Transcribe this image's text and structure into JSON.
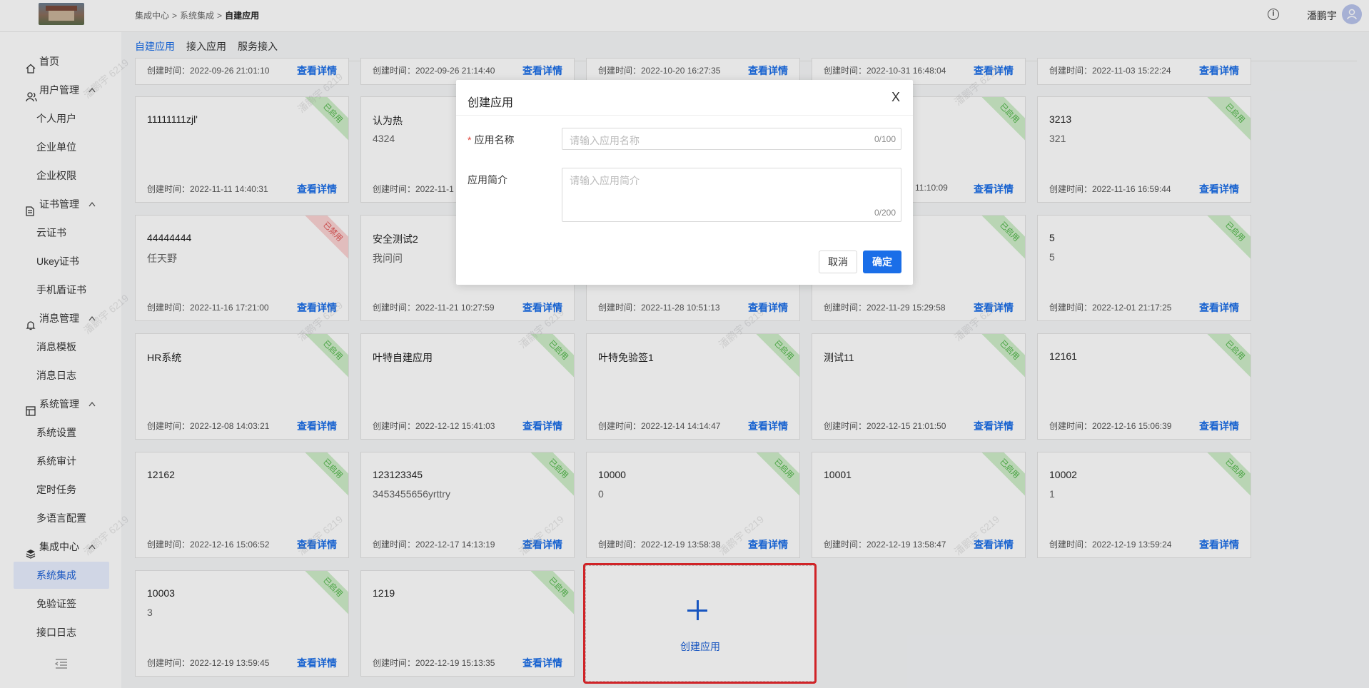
{
  "header": {
    "breadcrumb": [
      "集成中心",
      "系统集成",
      "自建应用"
    ],
    "breadcrumb_sep": ">",
    "username": "潘鹏宇"
  },
  "sidebar": {
    "items": [
      {
        "label": "首页",
        "icon": "home-icon",
        "type": "group"
      },
      {
        "label": "用户管理",
        "icon": "users-icon",
        "type": "group",
        "expanded": true
      },
      {
        "label": "个人用户",
        "type": "child"
      },
      {
        "label": "企业单位",
        "type": "child"
      },
      {
        "label": "企业权限",
        "type": "child"
      },
      {
        "label": "证书管理",
        "icon": "certificate-icon",
        "type": "group",
        "expanded": true
      },
      {
        "label": "云证书",
        "type": "child"
      },
      {
        "label": "Ukey证书",
        "type": "child"
      },
      {
        "label": "手机盾证书",
        "type": "child"
      },
      {
        "label": "消息管理",
        "icon": "bell-icon",
        "type": "group",
        "expanded": true
      },
      {
        "label": "消息模板",
        "type": "child"
      },
      {
        "label": "消息日志",
        "type": "child"
      },
      {
        "label": "系统管理",
        "icon": "system-icon",
        "type": "group",
        "expanded": true
      },
      {
        "label": "系统设置",
        "type": "child"
      },
      {
        "label": "系统审计",
        "type": "child"
      },
      {
        "label": "定时任务",
        "type": "child"
      },
      {
        "label": "多语言配置",
        "type": "child"
      },
      {
        "label": "集成中心",
        "icon": "layers-icon",
        "type": "group",
        "expanded": true
      },
      {
        "label": "系统集成",
        "type": "child",
        "active": true
      },
      {
        "label": "免验证签",
        "type": "child"
      },
      {
        "label": "接口日志",
        "type": "child"
      }
    ]
  },
  "tabs": [
    "自建应用",
    "接入应用",
    "服务接入"
  ],
  "detail_label": "查看详情",
  "time_prefix": "创建时间：",
  "status": {
    "enabled": "已启用",
    "disabled": "已禁用"
  },
  "cards_partial_row": [
    {
      "time": "2022-09-26 21:01:10"
    },
    {
      "time": "2022-09-26 21:14:40"
    },
    {
      "time": "2022-10-20 16:27:35"
    },
    {
      "time": "2022-10-31 16:48:04"
    },
    {
      "time": "2022-11-03 15:22:24"
    }
  ],
  "cards": [
    {
      "name": "11111111zjl'",
      "desc": "",
      "time": "2022-11-11 14:40:31",
      "status": "enabled"
    },
    {
      "name": "认为热",
      "desc": "4324",
      "time": "2022-11-1",
      "status": "enabled"
    },
    {
      "name": "",
      "desc": "",
      "time": "",
      "status": "enabled"
    },
    {
      "name": "",
      "desc": "",
      "time": "11:10:09",
      "status": "enabled"
    },
    {
      "name": "3213",
      "desc": "321",
      "time": "2022-11-16 16:59:44",
      "status": "enabled"
    },
    {
      "name": "44444444",
      "desc": "任天野",
      "time": "2022-11-16 17:21:00",
      "status": "disabled"
    },
    {
      "name": "安全测试2",
      "desc": "我问问",
      "time": "2022-11-21 10:27:59",
      "status": "enabled"
    },
    {
      "name": "",
      "desc": "",
      "time": "2022-11-28 10:51:13",
      "status": "enabled"
    },
    {
      "name": "",
      "desc": "",
      "time": "2022-11-29 15:29:58",
      "status": "enabled"
    },
    {
      "name": "5",
      "desc": "5",
      "time": "2022-12-01 21:17:25",
      "status": "enabled"
    },
    {
      "name": "HR系统",
      "desc": "",
      "time": "2022-12-08 14:03:21",
      "status": "enabled"
    },
    {
      "name": "叶特自建应用",
      "desc": "",
      "time": "2022-12-12 15:41:03",
      "status": "enabled"
    },
    {
      "name": "叶特免验签1",
      "desc": "",
      "time": "2022-12-14 14:14:47",
      "status": "enabled"
    },
    {
      "name": "测试11",
      "desc": "",
      "time": "2022-12-15 21:01:50",
      "status": "enabled"
    },
    {
      "name": "12161",
      "desc": "",
      "time": "2022-12-16 15:06:39",
      "status": "enabled"
    },
    {
      "name": "12162",
      "desc": "",
      "time": "2022-12-16 15:06:52",
      "status": "enabled"
    },
    {
      "name": "123123345",
      "desc": "3453455656yrttry",
      "time": "2022-12-17 14:13:19",
      "status": "enabled"
    },
    {
      "name": "10000",
      "desc": "0",
      "time": "2022-12-19 13:58:38",
      "status": "enabled"
    },
    {
      "name": "10001",
      "desc": "",
      "time": "2022-12-19 13:58:47",
      "status": "enabled"
    },
    {
      "name": "10002",
      "desc": "1",
      "time": "2022-12-19 13:59:24",
      "status": "enabled"
    },
    {
      "name": "10003",
      "desc": "3",
      "time": "2022-12-19 13:59:45",
      "status": "enabled"
    },
    {
      "name": "1219",
      "desc": "",
      "time": "2022-12-19 15:13:35",
      "status": "enabled"
    }
  ],
  "create_card": {
    "label": "创建应用"
  },
  "watermark": "潘鹏宇 6219",
  "modal": {
    "title": "创建应用",
    "close": "X",
    "name_label": "应用名称",
    "name_placeholder": "请输入应用名称",
    "name_count": "0/100",
    "intro_label": "应用简介",
    "intro_placeholder": "请输入应用简介",
    "intro_count": "0/200",
    "cancel": "取消",
    "ok": "确定"
  },
  "colors": {
    "primary": "#1a6ee8",
    "enabled_ribbon": "#cfeec9",
    "disabled_ribbon": "#fbd3d3",
    "highlight": "#e8282c"
  }
}
